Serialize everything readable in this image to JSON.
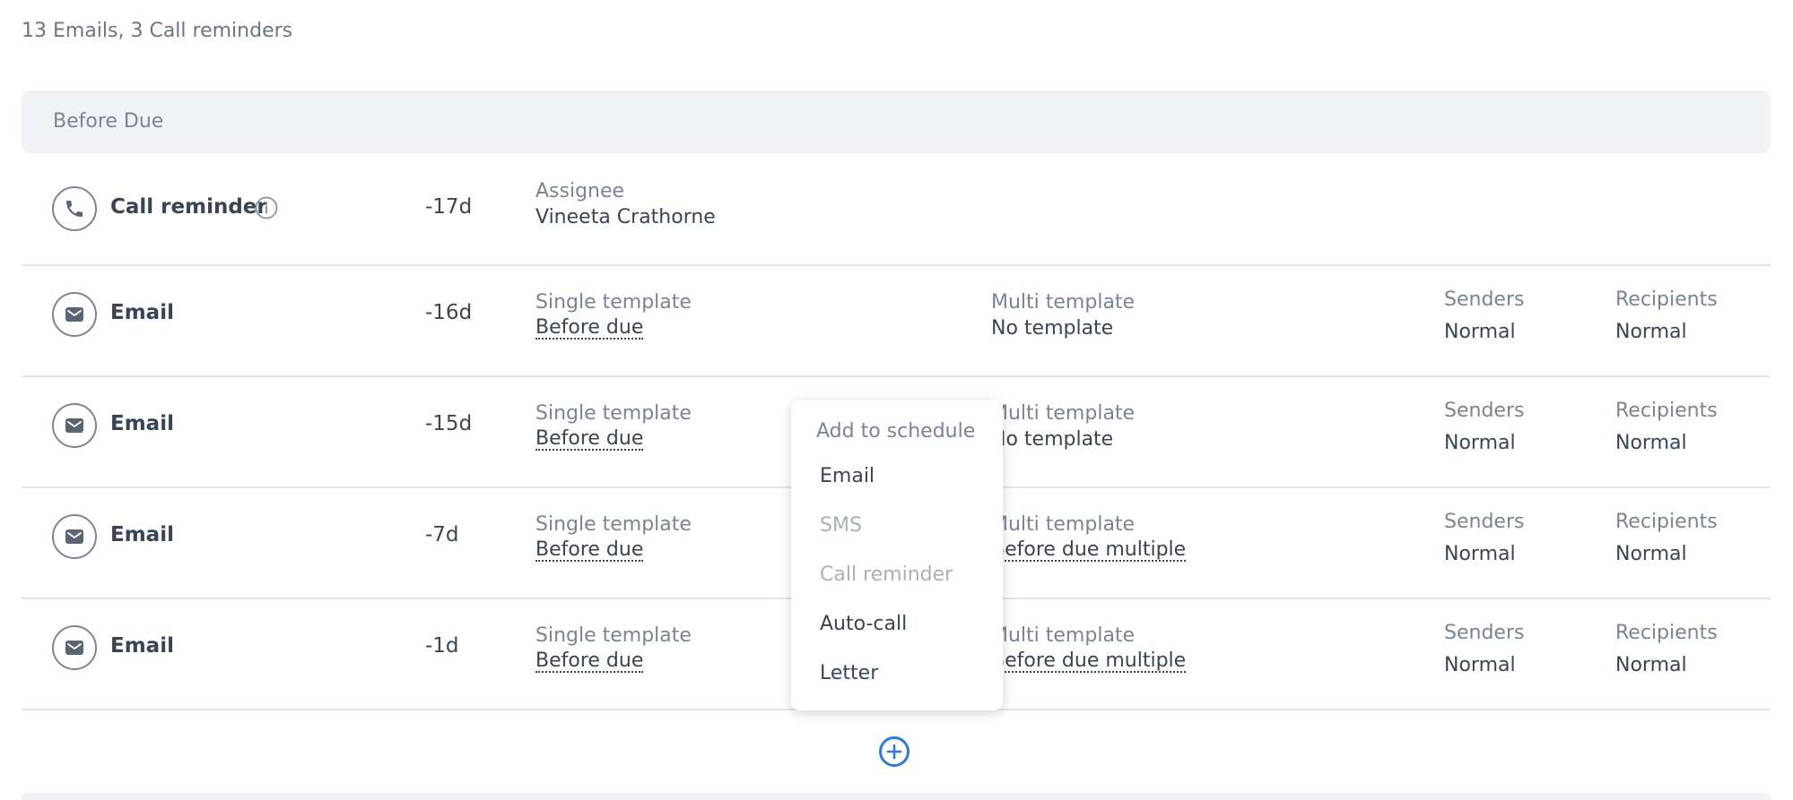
{
  "summary": "13 Emails, 3 Call reminders",
  "section": {
    "title": "Before Due"
  },
  "rows": [
    {
      "icon": "phone-icon",
      "type": "Call reminder",
      "offset": "-17d",
      "assignee_label": "Assignee",
      "assignee_value": "Vineeta Crathorne"
    },
    {
      "icon": "mail-icon",
      "type": "Email",
      "offset": "-16d",
      "single_label": "Single template",
      "single_value": "Before due",
      "multi_label": "Multi template",
      "multi_value": "No template",
      "senders_label": "Senders",
      "senders_value": "Normal",
      "recipients_label": "Recipients",
      "recipients_value": "Normal"
    },
    {
      "icon": "mail-icon",
      "type": "Email",
      "offset": "-15d",
      "single_label": "Single template",
      "single_value": "Before due",
      "multi_label": "Multi template",
      "multi_value": "No template",
      "senders_label": "Senders",
      "senders_value": "Normal",
      "recipients_label": "Recipients",
      "recipients_value": "Normal"
    },
    {
      "icon": "mail-icon",
      "type": "Email",
      "offset": "-7d",
      "single_label": "Single template",
      "single_value": "Before due",
      "multi_label": "Multi template",
      "multi_value": "Before due multiple",
      "senders_label": "Senders",
      "senders_value": "Normal",
      "recipients_label": "Recipients",
      "recipients_value": "Normal"
    },
    {
      "icon": "mail-icon",
      "type": "Email",
      "offset": "-1d",
      "single_label": "Single template",
      "single_value": "Before due",
      "multi_label": "Multi template",
      "multi_value": "Before due multiple",
      "senders_label": "Senders",
      "senders_value": "Normal",
      "recipients_label": "Recipients",
      "recipients_value": "Normal"
    }
  ],
  "menu": {
    "title": "Add to schedule",
    "items": [
      {
        "label": "Email",
        "enabled": true
      },
      {
        "label": "SMS",
        "enabled": false
      },
      {
        "label": "Call reminder",
        "enabled": false
      },
      {
        "label": "Auto-call",
        "enabled": true
      },
      {
        "label": "Letter",
        "enabled": true
      }
    ]
  },
  "add_button": {
    "icon": "plus-circle-icon"
  },
  "colors": {
    "accent": "#2f7ad6",
    "text": "#3a4553",
    "muted": "#7a8493",
    "section_bg": "#f1f3f7"
  }
}
